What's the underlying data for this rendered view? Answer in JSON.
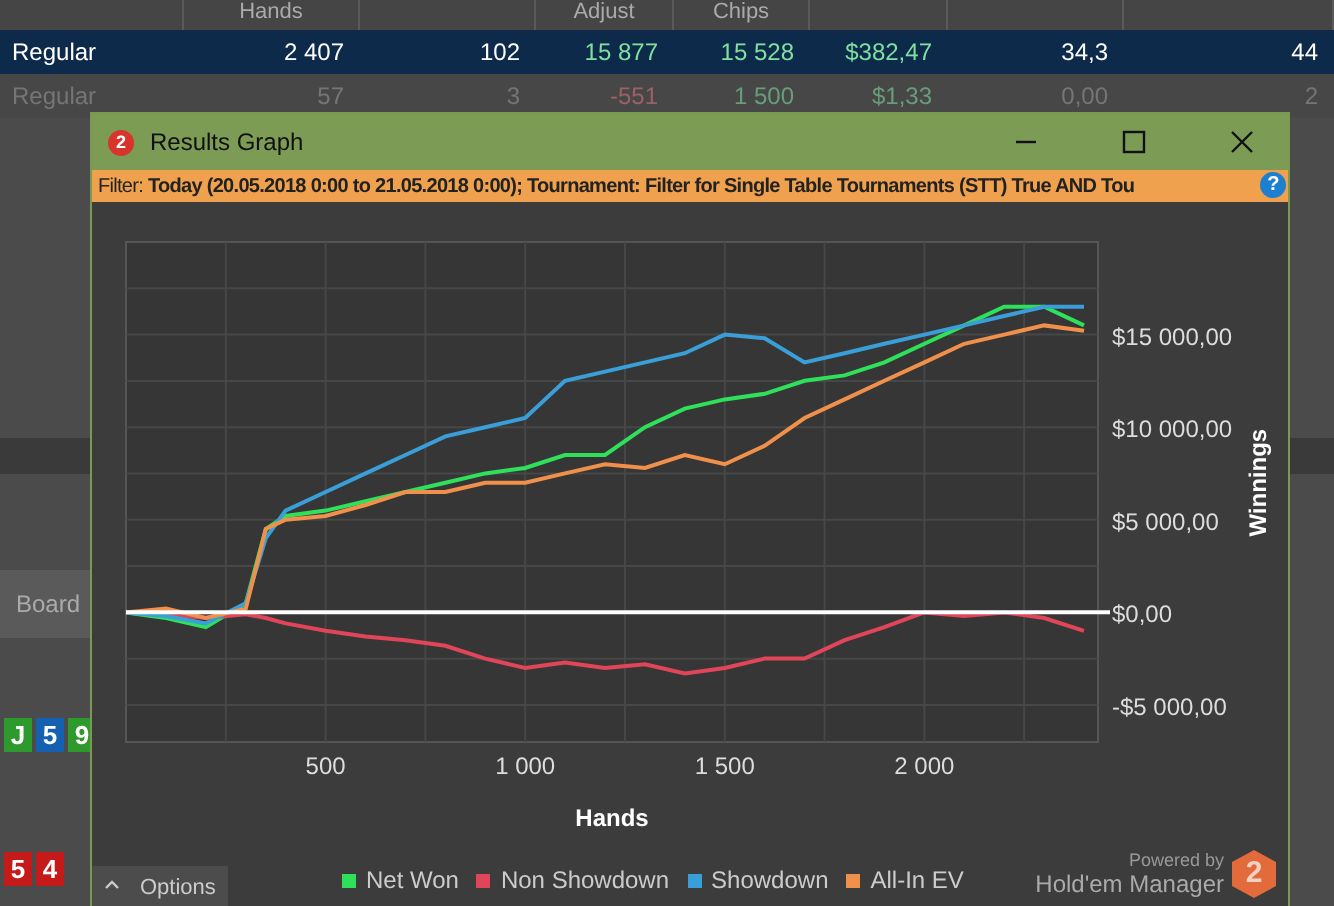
{
  "table": {
    "columns": [
      {},
      {
        "label": "Hands"
      },
      {},
      {
        "label": "Adjust"
      },
      {
        "label": "Chips"
      },
      {},
      {},
      {}
    ],
    "rows": [
      {
        "selected": true,
        "cells": [
          {
            "text": "Regular",
            "kind": "plain"
          },
          {
            "text": "2 407",
            "kind": "plain"
          },
          {
            "text": "102",
            "kind": "plain"
          },
          {
            "text": "15 877",
            "kind": "gain"
          },
          {
            "text": "15 528",
            "kind": "gain"
          },
          {
            "text": "$382,47",
            "kind": "gain"
          },
          {
            "text": "34,3",
            "kind": "plain"
          },
          {
            "text": "44",
            "kind": "plain"
          }
        ]
      },
      {
        "selected": false,
        "cells": [
          {
            "text": "Regular",
            "kind": "plain"
          },
          {
            "text": "57",
            "kind": "plain"
          },
          {
            "text": "3",
            "kind": "plain"
          },
          {
            "text": "-551",
            "kind": "loss"
          },
          {
            "text": "1 500",
            "kind": "gain"
          },
          {
            "text": "$1,33",
            "kind": "gain"
          },
          {
            "text": "0,00",
            "kind": "plain"
          },
          {
            "text": "2",
            "kind": "plain"
          }
        ]
      }
    ]
  },
  "side_panel": {
    "tab": "Board",
    "cards": [
      {
        "rank": "J",
        "kind": "club"
      },
      {
        "rank": "5",
        "kind": "diamond"
      },
      {
        "rank": "9",
        "kind": "club"
      }
    ],
    "cards_lower": [
      {
        "rank": "5",
        "kind": "heart"
      },
      {
        "rank": "4",
        "kind": "heart"
      }
    ]
  },
  "dialog": {
    "logo": "2",
    "title": "Results Graph",
    "filter": "Filter: **Today (20.05.2018 0:00 to 21.05.2018 0:00); Tournament: Filter for Single Table Tournaments (STT) True AND Tou**",
    "help": "?",
    "chart_data": {
      "type": "line",
      "xlabel": "Hands",
      "ylabel": "Winnings",
      "x": [
        0,
        100,
        200,
        300,
        350,
        400,
        500,
        600,
        700,
        800,
        900,
        1000,
        1100,
        1200,
        1300,
        1400,
        1500,
        1600,
        1700,
        1800,
        1900,
        2000,
        2100,
        2200,
        2300,
        2400
      ],
      "series": [
        {
          "name": "Net Won",
          "color": "#2ee05a",
          "values": [
            0,
            -300,
            -800,
            500,
            4500,
            5200,
            5500,
            6000,
            6500,
            7000,
            7500,
            7800,
            8500,
            8500,
            10000,
            11000,
            11500,
            11800,
            12500,
            12800,
            13500,
            14500,
            15500,
            16500,
            16500,
            15500
          ]
        },
        {
          "name": "Non Showdown",
          "color": "#e0455a",
          "values": [
            0,
            -100,
            -300,
            -100,
            -300,
            -600,
            -1000,
            -1300,
            -1500,
            -1800,
            -2500,
            -3000,
            -2700,
            -3000,
            -2800,
            -3300,
            -3000,
            -2500,
            -2500,
            -1500,
            -800,
            0,
            -200,
            0,
            -300,
            -1000
          ]
        },
        {
          "name": "Showdown",
          "color": "#3a9fd8",
          "values": [
            0,
            -200,
            -600,
            500,
            4000,
            5500,
            6500,
            7500,
            8500,
            9500,
            10000,
            10500,
            12500,
            13000,
            13500,
            14000,
            15000,
            14800,
            13500,
            14000,
            14500,
            15000,
            15500,
            16000,
            16500,
            16500
          ]
        },
        {
          "name": "All-In EV",
          "color": "#f0904a",
          "values": [
            0,
            200,
            -300,
            200,
            4500,
            5000,
            5200,
            5800,
            6500,
            6500,
            7000,
            7000,
            7500,
            8000,
            7800,
            8500,
            8000,
            9000,
            10500,
            11500,
            12500,
            13500,
            14500,
            15000,
            15500,
            15200
          ]
        }
      ],
      "xlim": [
        0,
        2435
      ],
      "ylim": [
        -7000,
        20000
      ],
      "grid": true,
      "xticks": [
        {
          "value": 500,
          "label": "500"
        },
        {
          "value": 1000,
          "label": "1 000"
        },
        {
          "value": 1500,
          "label": "1 500"
        },
        {
          "value": 2000,
          "label": "2 000"
        }
      ],
      "yticks": [
        {
          "value": -5000,
          "label": "-$5 000,00"
        },
        {
          "value": 0,
          "label": "$0,00"
        },
        {
          "value": 5000,
          "label": "$5 000,00"
        },
        {
          "value": 10000,
          "label": "$10 000,00"
        },
        {
          "value": 15000,
          "label": "$15 000,00"
        }
      ]
    },
    "options": "Options",
    "powered_by": "Powered by",
    "brand": "Hold'em Manager",
    "brand_logo": "2"
  }
}
